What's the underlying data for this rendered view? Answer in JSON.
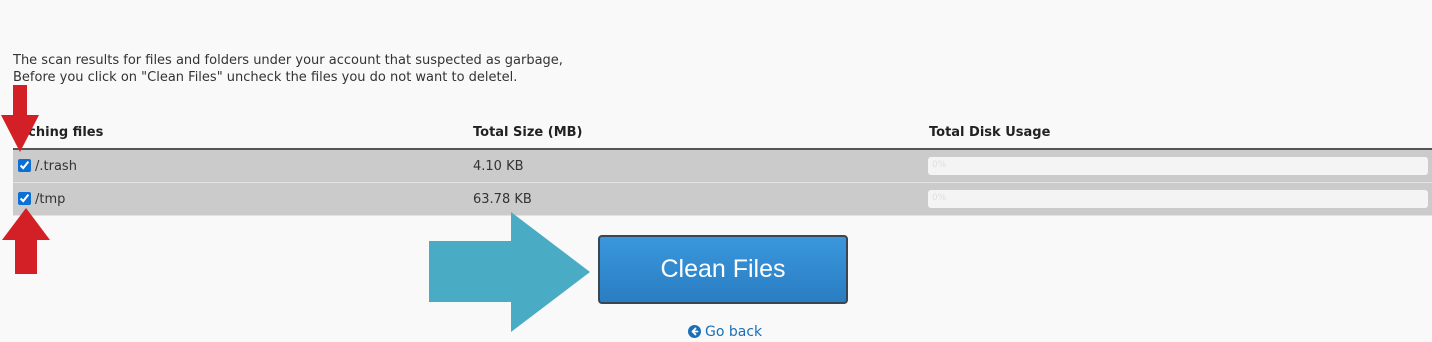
{
  "intro": {
    "line1": "The scan results for files and folders under your account that suspected as garbage,",
    "line2": "Before you click on \"Clean Files\" uncheck the files you do not want to deletel."
  },
  "table": {
    "headers": {
      "files": "arching files",
      "size": "Total Size (MB)",
      "usage": "Total Disk Usage"
    },
    "rows": [
      {
        "path": "/.trash",
        "size": "4.10 KB",
        "checked": true,
        "usage_fraction": 0.0,
        "usage_label": "0%"
      },
      {
        "path": "/tmp",
        "size": "63.78 KB",
        "checked": true,
        "usage_fraction": 0.0,
        "usage_label": "0%"
      }
    ]
  },
  "actions": {
    "clean_label": "Clean Files",
    "go_back_label": "Go back"
  },
  "icons": {
    "go_back": "arrow-circle-left-icon",
    "annotation_down": "red-arrow-down-icon",
    "annotation_up": "red-arrow-up-icon",
    "annotation_right": "teal-arrow-right-icon"
  },
  "colors": {
    "button": "#2f88cf",
    "row_bg": "#cbcbcb",
    "annotation_red": "#d32027",
    "annotation_teal": "#4aabc4",
    "link": "#1a6fb6"
  }
}
